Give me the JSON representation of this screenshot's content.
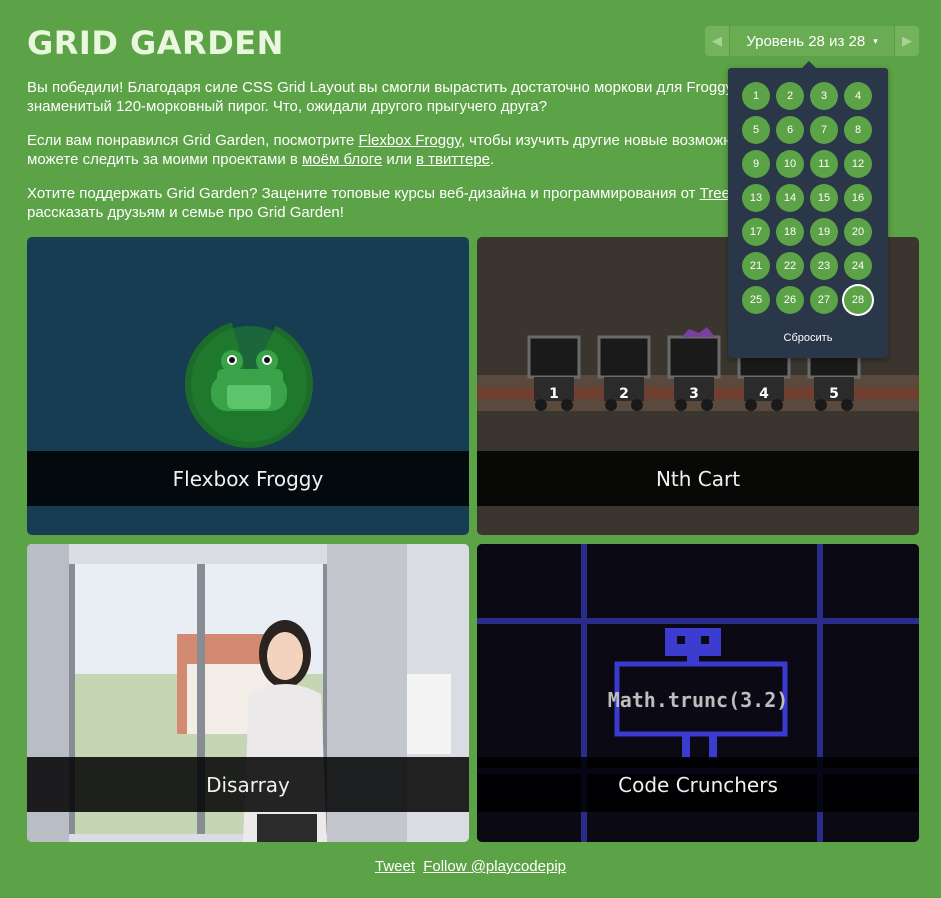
{
  "header": {
    "title": "GRID GARDEN",
    "level_label": "Уровень 28 из 28",
    "prev_label": "◀",
    "next_label": "▶",
    "caret": "▾"
  },
  "intro": {
    "p1": "Вы победили! Благодаря силе CSS Grid Layout вы смогли вырастить достаточно моркови для Froggy, чтобы испечь свой знаменитый 120-морковный пирог. Что, ожидали другого прыгучего друга?",
    "p2_before": "Если вам понравился Grid Garden, посмотрите ",
    "p2_link1": "Flexbox Froggy",
    "p2_middle": ", чтобы изучить другие новые возможности CSS. Вы также можете следить за моими проектами в ",
    "p2_link2": "моём блоге",
    "p2_or": " или ",
    "p2_link3": "в твиттере",
    "p2_end": ".",
    "p3_before": "Хотите поддержать Grid Garden? Зацените топовые курсы веб-дизайна и программирования от ",
    "p3_link": "Treehouse",
    "p3_after": ". И не забудьте рассказать друзьям и семье про Grid Garden!"
  },
  "levels": {
    "items": [
      "1",
      "2",
      "3",
      "4",
      "5",
      "6",
      "7",
      "8",
      "9",
      "10",
      "11",
      "12",
      "13",
      "14",
      "15",
      "16",
      "17",
      "18",
      "19",
      "20",
      "21",
      "22",
      "23",
      "24",
      "25",
      "26",
      "27",
      "28"
    ],
    "current": "28",
    "reset_label": "Сбросить"
  },
  "cards": {
    "froggy": "Flexbox Froggy",
    "nth": "Nth Cart",
    "disarray": "Disarray",
    "code": "Code Crunchers",
    "code_text": "Math.trunc(3.2)",
    "cart_numbers": [
      "1",
      "2",
      "3",
      "4",
      "5"
    ]
  },
  "footer": {
    "tweet": "Tweet",
    "follow": "Follow @playcodepip"
  },
  "colors": {
    "background": "#5ca246",
    "dropdown": "#293749",
    "level_circle": "#5ca246"
  }
}
